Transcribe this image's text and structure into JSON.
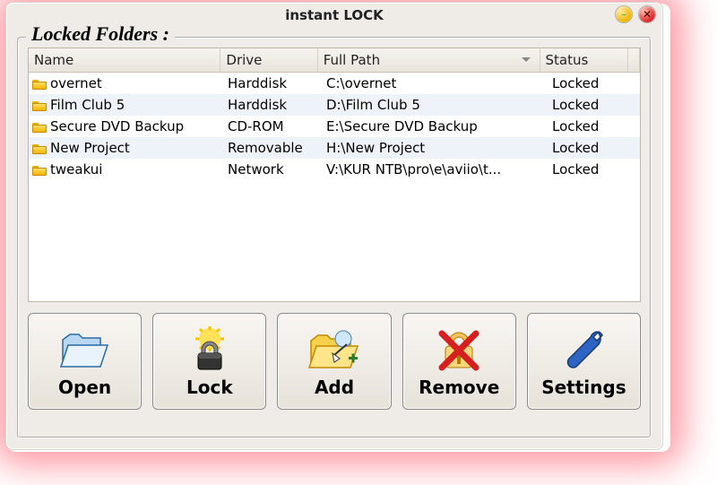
{
  "window": {
    "title": "instant LOCK"
  },
  "group_title": "Locked Folders :",
  "columns": {
    "name": "Name",
    "drive": "Drive",
    "path": "Full Path",
    "status": "Status"
  },
  "rows": [
    {
      "name": "overnet",
      "drive": "Harddisk",
      "path": "C:\\overnet",
      "status": "Locked"
    },
    {
      "name": "Film Club 5",
      "drive": "Harddisk",
      "path": "D:\\Film Club 5",
      "status": "Locked"
    },
    {
      "name": "Secure DVD Backup",
      "drive": "CD-ROM",
      "path": "E:\\Secure DVD Backup",
      "status": "Locked"
    },
    {
      "name": "New Project",
      "drive": "Removable",
      "path": "H:\\New Project",
      "status": "Locked"
    },
    {
      "name": "tweakui",
      "drive": "Network",
      "path": "V:\\KUR NTB\\pro\\e\\aviio\\t...",
      "status": "Locked"
    }
  ],
  "buttons": {
    "open": "Open",
    "lock": "Lock",
    "add": "Add",
    "remove": "Remove",
    "settings": "Settings"
  }
}
